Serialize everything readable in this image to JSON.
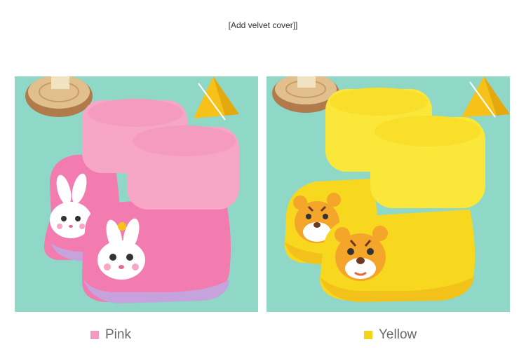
{
  "caption": "[Add velvet cover]]",
  "variants": [
    {
      "name": "Pink",
      "swatch_color": "#f29ac4",
      "boot_color": "#f27bb0",
      "cuff_color": "#f7a6c6",
      "character": "bunny-icon"
    },
    {
      "name": "Yellow",
      "swatch_color": "#f5d21c",
      "boot_color": "#f7d81e",
      "cuff_color": "#fbe63a",
      "character": "tiger-icon"
    }
  ],
  "colors": {
    "background": "#ffffff",
    "photo_background": "#8fd8c8",
    "label_text": "#6a6a6a"
  }
}
